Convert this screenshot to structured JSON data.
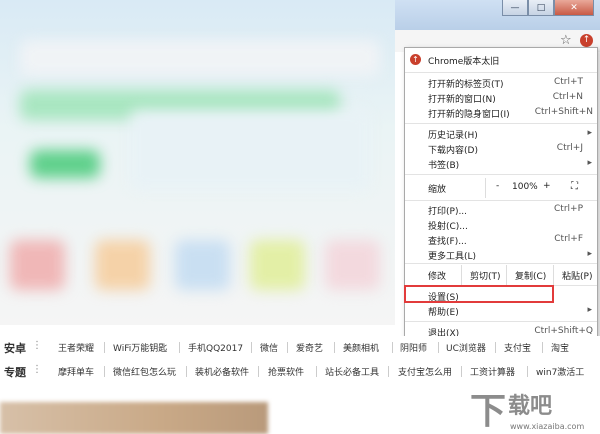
{
  "window": {
    "minimize_icon": "minimize-icon",
    "maximize_icon": "maximize-icon",
    "close_icon": "close-icon"
  },
  "toolbar": {
    "bookmark_icon": "star-icon",
    "menu_icon": "update-menu-icon"
  },
  "menu": {
    "header": "Chrome版本太旧",
    "items": [
      {
        "label": "打开新的标签页(T)",
        "shortcut": "Ctrl+T"
      },
      {
        "label": "打开新的窗口(N)",
        "shortcut": "Ctrl+N"
      },
      {
        "label": "打开新的隐身窗口(I)",
        "shortcut": "Ctrl+Shift+N"
      },
      {
        "label": "历史记录(H)",
        "shortcut": "▸"
      },
      {
        "label": "下载内容(D)",
        "shortcut": "Ctrl+J"
      },
      {
        "label": "书签(B)",
        "shortcut": "▸"
      },
      {
        "label": "打印(P)...",
        "shortcut": "Ctrl+P"
      },
      {
        "label": "投射(C)...",
        "shortcut": ""
      },
      {
        "label": "查找(F)...",
        "shortcut": "Ctrl+F"
      },
      {
        "label": "更多工具(L)",
        "shortcut": "▸"
      },
      {
        "label": "设置(S)",
        "shortcut": ""
      },
      {
        "label": "帮助(E)",
        "shortcut": "▸"
      },
      {
        "label": "退出(X)",
        "shortcut": "Ctrl+Shift+Q"
      }
    ],
    "zoom": {
      "label": "缩放",
      "minus": "-",
      "value": "100%",
      "plus": "+",
      "fullscreen_icon": "fullscreen-icon"
    },
    "edit": {
      "label": "修改",
      "cut": "剪切(T)",
      "copy": "复制(C)",
      "paste": "粘贴(P)"
    }
  },
  "rows": [
    {
      "title": "安卓",
      "items": [
        "王者荣耀",
        "WiFi万能钥匙",
        "手机QQ2017",
        "微信",
        "爱奇艺",
        "美颜相机",
        "阴阳师",
        "UC浏览器",
        "支付宝",
        "淘宝"
      ]
    },
    {
      "title": "专题",
      "items": [
        "摩拜单车",
        "微信红包怎么玩",
        "装机必备软件",
        "抢票软件",
        "站长必备工具",
        "支付宝怎么用",
        "工资计算器",
        "win7激活工"
      ]
    }
  ],
  "watermark": {
    "glyph": "下",
    "text": "载吧",
    "url": "www.xiazaiba.com"
  },
  "colors": {
    "accent_red": "#e23b3b",
    "update_icon": "#c9402c"
  }
}
